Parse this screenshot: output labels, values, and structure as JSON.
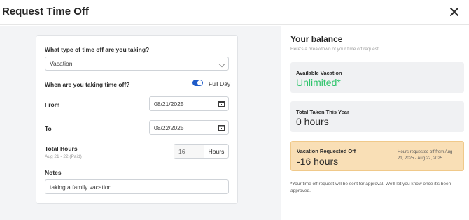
{
  "header": {
    "title": "Request Time Off"
  },
  "form": {
    "type_question": "What type of time off are you taking?",
    "type_selected": "Vacation",
    "when_question": "When are you taking time off?",
    "full_day_label": "Full Day",
    "full_day_on": true,
    "from_label": "From",
    "from_value": "08/21/2025",
    "to_label": "To",
    "to_value": "08/22/2025",
    "total_hours_label": "Total Hours",
    "total_hours_sub": "Aug 21 - 22 (Paid)",
    "hours_value": "16",
    "hours_unit": "Hours",
    "notes_label": "Notes",
    "notes_value": "taking a family vacation"
  },
  "balance": {
    "title": "Your balance",
    "subtitle": "Here's a breakdown of your time off request",
    "available_label": "Available Vacation",
    "available_value": "Unlimited*",
    "taken_label": "Total Taken This Year",
    "taken_value": "0 hours",
    "requested_label": "Vacation Requested Off",
    "requested_value": "-16 hours",
    "requested_note": "Hours requested off from Aug 21, 2025 - Aug 22, 2025",
    "footnote": "*Your time off request will be sent for approval. We'll let you know once it's been approved."
  },
  "colors": {
    "toggle_accent": "#1f5cc9",
    "unlimited_green": "#2ec46b",
    "requested_bg": "#f9dfb6"
  },
  "icons": {
    "close": "close-icon",
    "chevron": "chevron-down-icon",
    "calendar": "calendar-icon"
  }
}
